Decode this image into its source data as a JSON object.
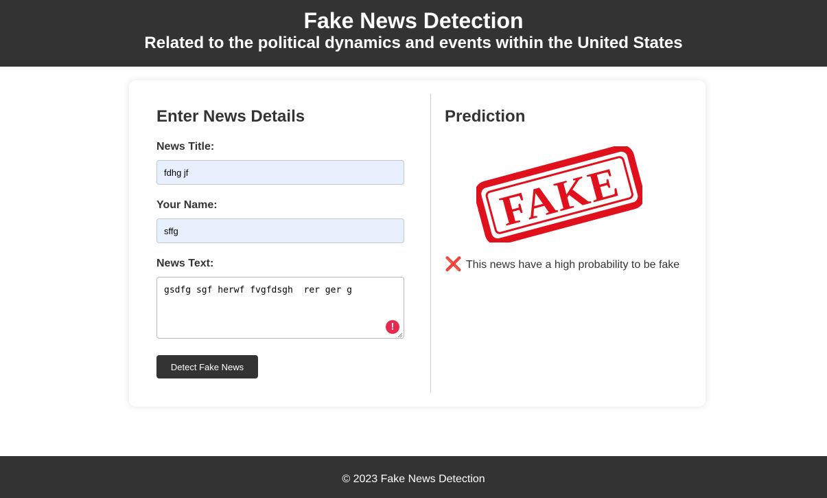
{
  "header": {
    "title": "Fake News Detection",
    "subtitle": "Related to the political dynamics and events within the United States"
  },
  "form": {
    "heading": "Enter News Details",
    "title_label": "News Title:",
    "title_value": "fdhg jf",
    "name_label": "Your Name:",
    "name_value": "sffg",
    "text_label": "News Text:",
    "text_value": "gsdfg sgf herwf fvgfdsgh  rer ger g",
    "submit_label": "Detect Fake News",
    "validation_icon": "exclamation-alert-icon"
  },
  "prediction": {
    "heading": "Prediction",
    "stamp_text": "FAKE",
    "result_icon": "❌",
    "result_text": "This news have a high probability to be fake"
  },
  "footer": {
    "text": "© 2023 Fake News Detection"
  },
  "colors": {
    "header_bg": "#333333",
    "stamp_red": "#e0101c",
    "alert_red": "#e5294f",
    "input_autofill_bg": "#e8f0fe"
  }
}
